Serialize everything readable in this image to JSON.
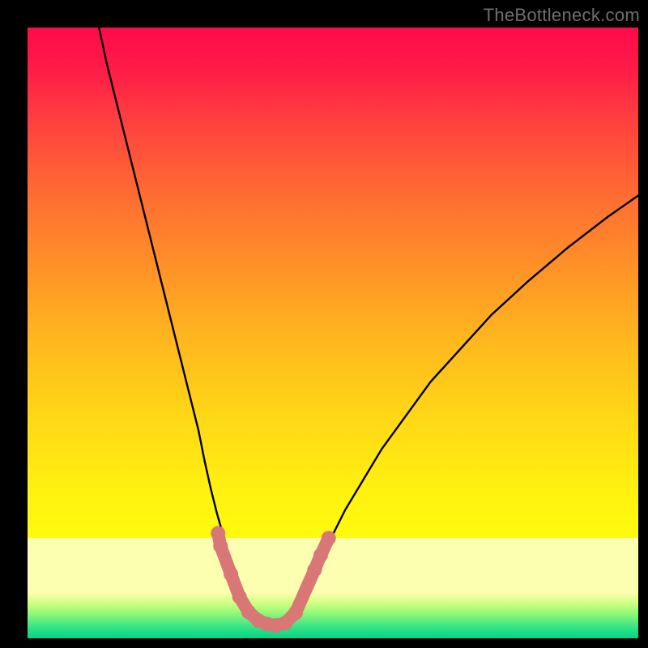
{
  "watermark": "TheBottleneck.com",
  "chart_data": {
    "type": "line",
    "title": "",
    "xlabel": "",
    "ylabel": "",
    "xlim": [
      0,
      100
    ],
    "ylim": [
      0,
      100
    ],
    "series": [
      {
        "name": "left-curve",
        "x": [
          11.7,
          13.0,
          14.5,
          16.0,
          17.5,
          19.0,
          20.5,
          22.0,
          23.5,
          25.0,
          26.5,
          28.0,
          29.0,
          30.0,
          31.0,
          32.0,
          33.0,
          34.0,
          35.5,
          38.5
        ],
        "y": [
          100.0,
          94.0,
          88.0,
          82.0,
          76.0,
          70.0,
          64.0,
          58.0,
          52.0,
          46.0,
          40.0,
          34.0,
          29.0,
          24.5,
          20.5,
          17.0,
          13.5,
          10.5,
          6.0,
          2.1
        ]
      },
      {
        "name": "right-curve",
        "x": [
          43.0,
          45.0,
          47.0,
          49.5,
          52.0,
          55.0,
          58.0,
          62.0,
          66.0,
          71.0,
          76.0,
          82.0,
          88.5,
          95.0,
          100.0
        ],
        "y": [
          2.1,
          6.5,
          11.0,
          16.0,
          21.0,
          26.0,
          31.0,
          36.5,
          42.0,
          47.5,
          53.0,
          58.5,
          64.0,
          69.0,
          72.5
        ]
      }
    ],
    "trough_markers": {
      "name": "pink-trough-markers",
      "color": "#d97777",
      "points": [
        {
          "x": 31.2,
          "y": 17.2
        },
        {
          "x": 31.6,
          "y": 15.1
        },
        {
          "x": 33.3,
          "y": 10.5
        },
        {
          "x": 34.7,
          "y": 6.8
        },
        {
          "x": 36.2,
          "y": 4.3
        },
        {
          "x": 37.8,
          "y": 2.9
        },
        {
          "x": 39.3,
          "y": 2.3
        },
        {
          "x": 40.7,
          "y": 2.1
        },
        {
          "x": 42.2,
          "y": 2.5
        },
        {
          "x": 43.9,
          "y": 4.2
        },
        {
          "x": 47.0,
          "y": 11.2
        },
        {
          "x": 48.0,
          "y": 13.6
        },
        {
          "x": 49.3,
          "y": 16.4
        }
      ]
    },
    "background_bands": [
      {
        "name": "top-gradient",
        "from_y": 16.5,
        "to_y": 100,
        "colors": [
          "#fffb0d",
          "#ff0a4b"
        ]
      },
      {
        "name": "pale-band",
        "from_y": 7.3,
        "to_y": 16.5,
        "color": "#fcfeb0"
      },
      {
        "name": "bottom-gradient",
        "from_y": 0,
        "to_y": 7.3,
        "colors": [
          "#07d588",
          "#f6ffa8"
        ]
      }
    ]
  }
}
